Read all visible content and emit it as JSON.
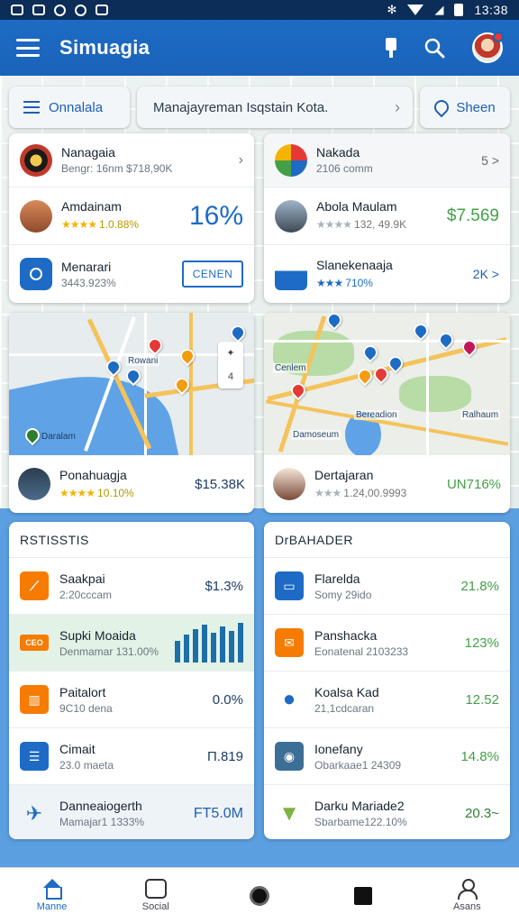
{
  "status_bar": {
    "time": "13:38"
  },
  "app_bar": {
    "title": "Simuagia"
  },
  "search_row": {
    "left_chip": "Onnalala",
    "query": "Manajayreman Isqstain Kota.",
    "right_chip": "Sheen"
  },
  "card_top_left": {
    "rows": [
      {
        "title": "Nanagaia",
        "subtitle": "Bengr: 16nm $718,90K"
      },
      {
        "title": "Amdainam",
        "stars": "★★★★",
        "rating": "1.0.88%",
        "value": "16%"
      },
      {
        "title": "Menarari",
        "subtitle": "3443.923%",
        "button": "CENEN"
      }
    ]
  },
  "card_top_right": {
    "rows": [
      {
        "title": "Nakada",
        "subtitle": "2106 comm",
        "value": "5 >"
      },
      {
        "title": "Abola Maulam",
        "stars": "★★★★",
        "rating": "132, 49.9K",
        "value": "$7.569"
      },
      {
        "title": "Slanekenaaja",
        "stars": "★★★",
        "rating": "710%",
        "value": "2K >"
      }
    ]
  },
  "map_card_left": {
    "map_label_1": "Rowani",
    "map_label_2": "Daralam",
    "zoom_label": "4",
    "title": "Ponahuagja",
    "stars": "★★★★",
    "rating": "10.10%",
    "value": "$15.38K"
  },
  "map_card_right": {
    "map_label_1": "Bereadion",
    "map_label_2": "Damoseum",
    "map_label_3": "Cenlem",
    "map_label_4": "Ralhaum",
    "title": "Dertajaran",
    "stars": "★★★",
    "rating": "1.24,00.9993",
    "value": "UN716%"
  },
  "stats_card": {
    "header": "RSTISSTIS",
    "rows": [
      {
        "title": "Saakpai",
        "subtitle": "2:20cccam",
        "value": "$1.3%"
      },
      {
        "title": "Supki Moaida",
        "subtitle": "Denmamar 131.00%",
        "badge": "CEO"
      },
      {
        "title": "Paitalort",
        "subtitle": "9C10 dena",
        "value": "0.0%"
      },
      {
        "title": "Cimait",
        "subtitle": "23.0 maeta",
        "value": "П.819"
      },
      {
        "title": "Danneaiogerth",
        "subtitle": "Mamajar1 1333%",
        "value": "FT5.0M"
      }
    ],
    "bars": [
      0.55,
      0.7,
      0.85,
      0.95,
      0.75,
      0.9,
      0.8,
      1.0
    ]
  },
  "dashboard_card": {
    "header": "DrBAHADER",
    "rows": [
      {
        "title": "Flarelda",
        "subtitle": "Somy 29ido",
        "value": "21.8%"
      },
      {
        "title": "Panshacka",
        "subtitle": "Eonatenal 2103233",
        "value": "123%"
      },
      {
        "title": "Koalsa Kad",
        "subtitle": "21,1cdcaran",
        "value": "12.52"
      },
      {
        "title": "Ionefany",
        "subtitle": "Obarkaae1 24309",
        "value": "14.8%"
      },
      {
        "title": "Darku Mariade2",
        "subtitle": "Sbarbame122.10%",
        "value": "20.3~"
      }
    ]
  },
  "bottom_nav": [
    {
      "label": "Manne",
      "icon": "home-icon"
    },
    {
      "label": "Social",
      "icon": "social-icon"
    },
    {
      "label": "",
      "icon": "record-icon"
    },
    {
      "label": "",
      "icon": "square-icon"
    },
    {
      "label": "Asans",
      "icon": "profile-icon"
    }
  ],
  "colors": {
    "app_bar": "#1a63ba",
    "status_bar": "#0b2d57",
    "accent_green": "#43a047",
    "accent_blue": "#1d6bc4",
    "background": "#5b9fe0"
  }
}
